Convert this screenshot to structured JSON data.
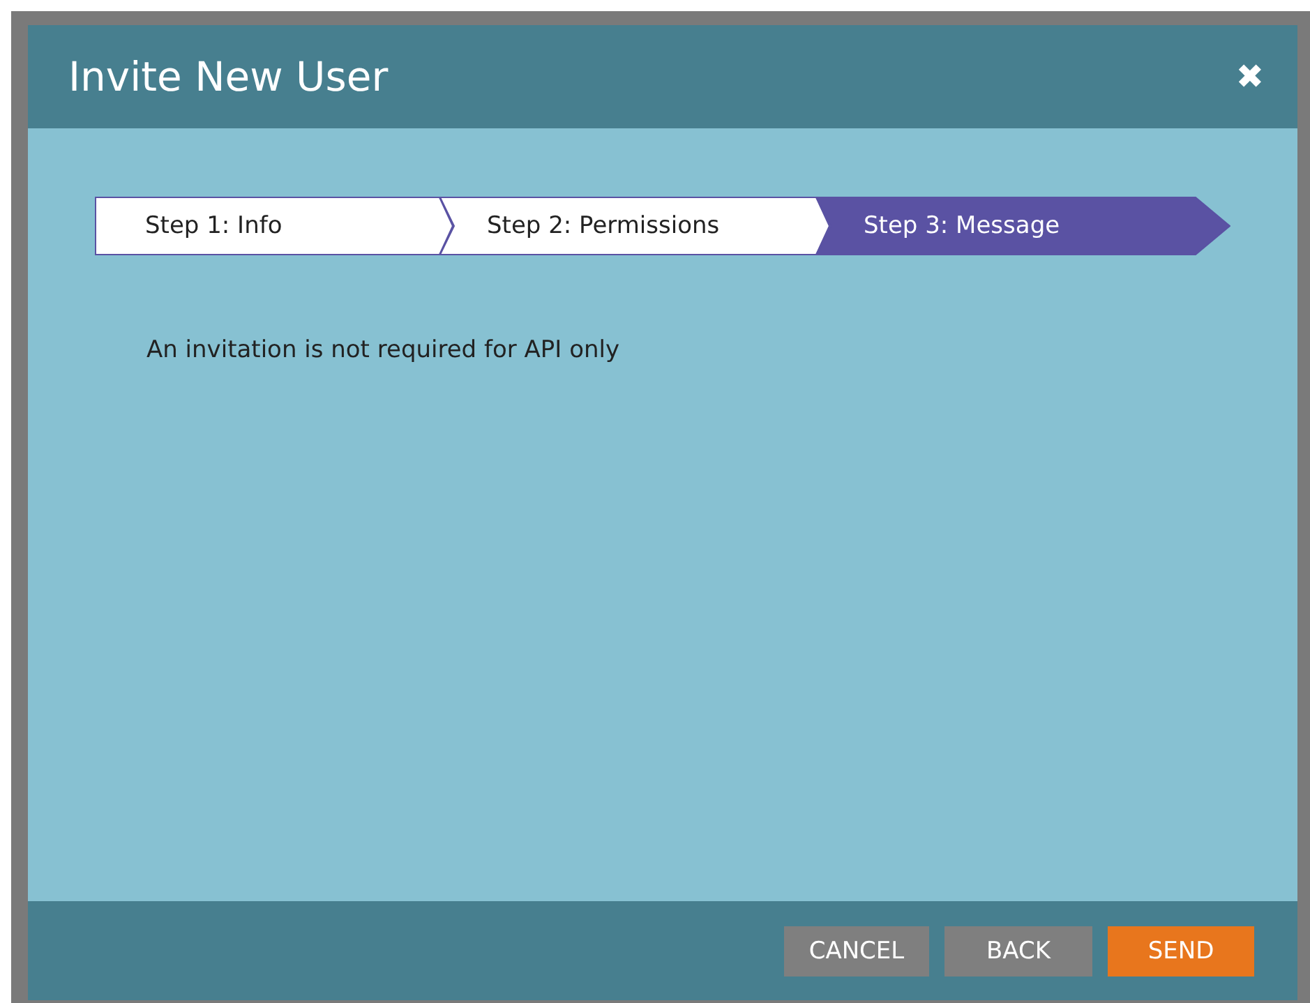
{
  "dialog": {
    "title": "Invite New User",
    "close": "✖"
  },
  "steps": [
    {
      "label": "Step 1: Info",
      "selected": false
    },
    {
      "label": "Step 2: Permissions",
      "selected": false
    },
    {
      "label": "Step 3: Message",
      "selected": true
    }
  ],
  "message": "An invitation is not required for API only",
  "buttons": [
    {
      "label": "CANCEL",
      "kind": "secondary"
    },
    {
      "label": "BACK",
      "kind": "secondary"
    },
    {
      "label": "SEND",
      "kind": "primary"
    }
  ]
}
